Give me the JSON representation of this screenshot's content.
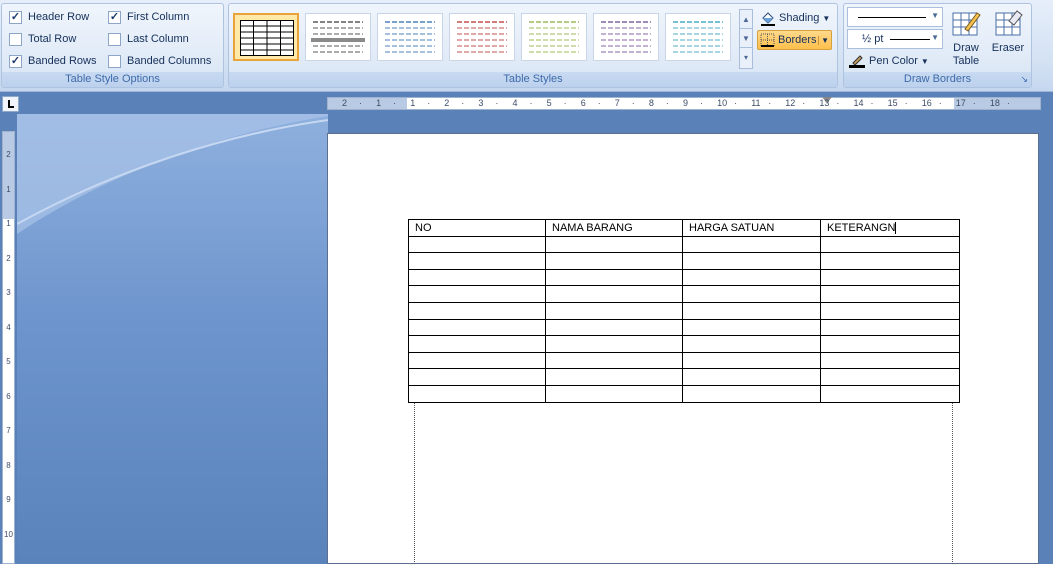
{
  "style_options": {
    "group_label": "Table Style Options",
    "items": [
      {
        "label": "Header Row",
        "checked": true
      },
      {
        "label": "Total Row",
        "checked": false
      },
      {
        "label": "Banded Rows",
        "checked": true
      },
      {
        "label": "First Column",
        "checked": true
      },
      {
        "label": "Last Column",
        "checked": false
      },
      {
        "label": "Banded Columns",
        "checked": false
      }
    ]
  },
  "table_styles": {
    "group_label": "Table Styles",
    "swatch_colors": [
      "#000000",
      "#5a5a5a",
      "#4f81bd",
      "#c0504d",
      "#9bbb59",
      "#8064a2",
      "#4bacc6"
    ],
    "shading_label": "Shading",
    "borders_label": "Borders",
    "shading_icon": "paint-bucket-icon",
    "borders_icon": "borders-icon"
  },
  "draw_borders": {
    "group_label": "Draw Borders",
    "pen_weight": "½ pt",
    "pen_color_label": "Pen Color",
    "draw_table_label": "Draw Table",
    "eraser_label": "Eraser"
  },
  "ruler": {
    "horizontal": [
      "2",
      "1",
      "1",
      "2",
      "3",
      "4",
      "5",
      "6",
      "7",
      "8",
      "9",
      "10",
      "11",
      "12",
      "13",
      "14",
      "15",
      "16",
      "17",
      "18"
    ],
    "vertical": [
      "2",
      "1",
      "1",
      "2",
      "3",
      "4",
      "5",
      "6",
      "7",
      "8",
      "9",
      "10"
    ]
  },
  "document": {
    "headers": [
      "NO",
      "NAMA BARANG",
      "HARGA SATUAN",
      "KETERANGN"
    ],
    "empty_rows": 10
  }
}
